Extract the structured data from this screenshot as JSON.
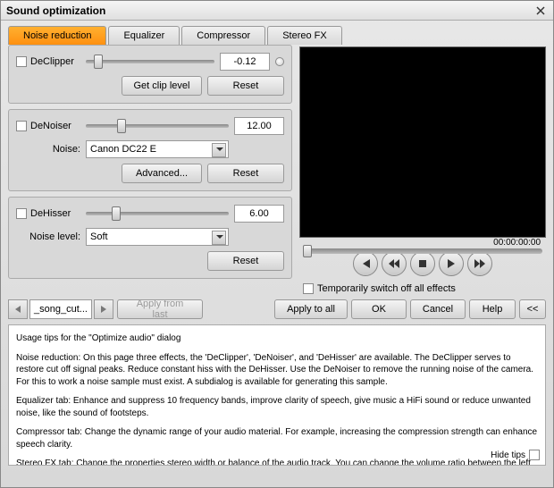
{
  "title": "Sound optimization",
  "tabs": [
    "Noise reduction",
    "Equalizer",
    "Compressor",
    "Stereo FX"
  ],
  "activeTab": 0,
  "declipper": {
    "label": "DeClipper",
    "value": "-0.12",
    "getClip": "Get clip level",
    "reset": "Reset",
    "sliderPos": 6
  },
  "denoiser": {
    "label": "DeNoiser",
    "value": "12.00",
    "noiseLabel": "Noise:",
    "noisePreset": "Canon DC22 E",
    "advanced": "Advanced...",
    "reset": "Reset",
    "sliderPos": 22
  },
  "dehisser": {
    "label": "DeHisser",
    "value": "6.00",
    "levelLabel": "Noise level:",
    "levelPreset": "Soft",
    "reset": "Reset",
    "sliderPos": 18
  },
  "timecode": "00:00:00:00",
  "tempSwitch": "Temporarily switch off all effects",
  "songName": "_song_cut...",
  "applyFromLast": "Apply from last",
  "applyToAll": "Apply to all",
  "ok": "OK",
  "cancel": "Cancel",
  "help": "Help",
  "collapse": "<<",
  "tips": {
    "heading": "Usage tips for the \"Optimize audio\" dialog",
    "p1": "Noise reduction: On this page three effects, the 'DeClipper', 'DeNoiser', and 'DeHisser' are available. The DeClipper serves to restore cut off signal peaks. Reduce constant hiss with the DeHisser. Use the DeNoiser to remove the running noise of the camera. For this to work a noise sample must exist. A subdialog is available for generating this sample.",
    "p2": "Equalizer tab: Enhance and suppress 10 frequency bands, improve clarity of speech, give music a HiFi sound or reduce unwanted noise, like the sound of footsteps.",
    "p3": "Compressor tab: Change the dynamic range of your audio material. For example, increasing the compression strength can enhance speech clarity.",
    "p4": "Stereo FX tab: Change the properties stereo width or balance of the audio track. You can change the volume ratio between the left and right channels and the width of the stereo field.",
    "hide": "Hide tips"
  }
}
